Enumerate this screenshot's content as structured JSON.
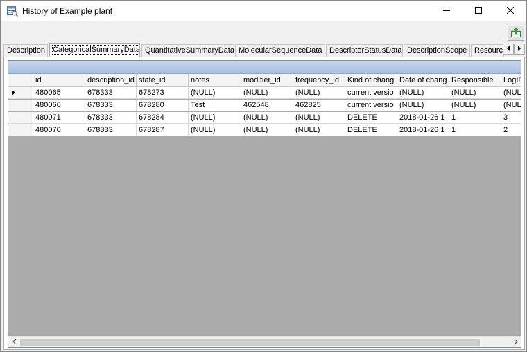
{
  "window": {
    "title": "History of Example plant"
  },
  "tabs": [
    {
      "label": "Description"
    },
    {
      "label": "CategoricalSummaryData"
    },
    {
      "label": "QuantitativeSummaryData"
    },
    {
      "label": "MolecularSequenceData"
    },
    {
      "label": "DescriptorStatusData"
    },
    {
      "label": "DescriptionScope"
    },
    {
      "label": "Resourc"
    }
  ],
  "active_tab": "CategoricalSummaryData",
  "grid": {
    "columns": [
      "id",
      "description_id",
      "state_id",
      "notes",
      "modifier_id",
      "frequency_id",
      "Kind of chang",
      "Date of chang",
      "Responsible",
      "LogID"
    ],
    "rows": [
      [
        "480065",
        "678333",
        "678273",
        "(NULL)",
        "(NULL)",
        "(NULL)",
        "current versio",
        "(NULL)",
        "(NULL)",
        "(NULL)"
      ],
      [
        "480066",
        "678333",
        "678280",
        "Test",
        "462548",
        "462825",
        "current versio",
        "(NULL)",
        "(NULL)",
        "(NULL)"
      ],
      [
        "480071",
        "678333",
        "678284",
        "(NULL)",
        "(NULL)",
        "(NULL)",
        "DELETE",
        "2018-01-26 1",
        "1",
        "3"
      ],
      [
        "480070",
        "678333",
        "678287",
        "(NULL)",
        "(NULL)",
        "(NULL)",
        "DELETE",
        "2018-01-26 1",
        "1",
        "2"
      ]
    ],
    "current_row": 0
  },
  "icons": {
    "app": "history-table-icon",
    "export": "export-icon",
    "minimize": "minimize-icon",
    "maximize": "maximize-icon",
    "close": "close-icon",
    "tab_left": "chevron-left-icon",
    "tab_right": "chevron-right-icon",
    "scroll_left": "chevron-left-icon",
    "scroll_right": "chevron-right-icon"
  },
  "colors": {
    "caption_bar": "#b7cbe8",
    "grid_background": "#ababab"
  }
}
